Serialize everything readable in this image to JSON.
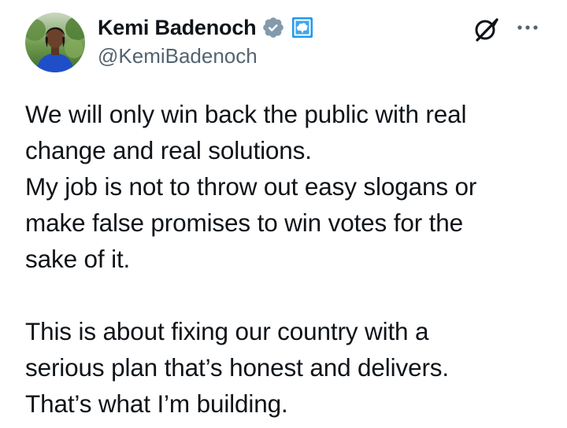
{
  "tweet": {
    "author": {
      "display_name": "Kemi Badenoch",
      "handle": "@KemiBadenoch",
      "avatar_icon": "profile-photo",
      "verified_icon": "verified-badge-icon",
      "affiliation_icon": "conservative-party-tree-icon"
    },
    "actions": {
      "grok_icon": "grok-icon",
      "more_icon": "more-options-icon"
    },
    "text": "We will only win back the public with real\nchange and real solutions.\nMy job is not to throw out easy slogans or\nmake false promises to win votes for the\nsake of it.\n\nThis is about fixing our country with a\nserious plan that’s honest and delivers.\nThat’s what I’m building."
  },
  "colors": {
    "text": "#0f1419",
    "secondary_text": "#536471",
    "verified_badge": "#829aab",
    "affiliation_blue": "#1d9bf0"
  }
}
